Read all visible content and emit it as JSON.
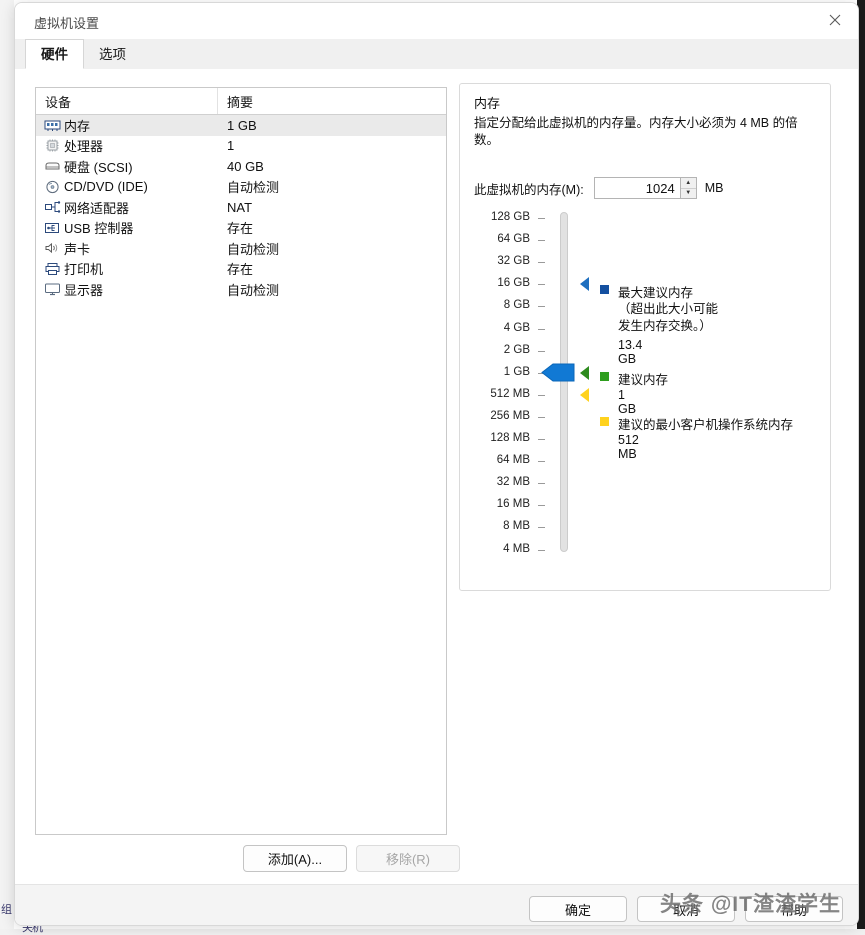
{
  "window": {
    "title": "虚拟机设置",
    "close_icon": "close-icon"
  },
  "tabs": [
    {
      "label": "硬件",
      "active": true
    },
    {
      "label": "选项",
      "active": false
    }
  ],
  "device_table": {
    "columns": [
      "设备",
      "摘要"
    ],
    "rows": [
      {
        "icon": "memory-icon",
        "device": "内存",
        "summary": "1 GB",
        "selected": true
      },
      {
        "icon": "cpu-icon",
        "device": "处理器",
        "summary": "1",
        "selected": false
      },
      {
        "icon": "harddisk-icon",
        "device": "硬盘 (SCSI)",
        "summary": "40 GB",
        "selected": false
      },
      {
        "icon": "cddvd-icon",
        "device": "CD/DVD (IDE)",
        "summary": "自动检测",
        "selected": false
      },
      {
        "icon": "network-icon",
        "device": "网络适配器",
        "summary": "NAT",
        "selected": false
      },
      {
        "icon": "usb-icon",
        "device": "USB 控制器",
        "summary": "存在",
        "selected": false
      },
      {
        "icon": "sound-icon",
        "device": "声卡",
        "summary": "自动检测",
        "selected": false
      },
      {
        "icon": "printer-icon",
        "device": "打印机",
        "summary": "存在",
        "selected": false
      },
      {
        "icon": "display-icon",
        "device": "显示器",
        "summary": "自动检测",
        "selected": false
      }
    ]
  },
  "list_buttons": {
    "add": "添加(A)...",
    "remove": "移除(R)"
  },
  "memory_panel": {
    "title": "内存",
    "description": "指定分配给此虚拟机的内存量。内存大小必须为 4 MB 的倍数。",
    "field_label": "此虚拟机的内存(M):",
    "field_value": "1024",
    "field_unit": "MB",
    "spinner_up_icon": "chevron-up-icon",
    "spinner_down_icon": "chevron-down-icon",
    "scale_labels": [
      "128 GB",
      "64 GB",
      "32 GB",
      "16 GB",
      "8 GB",
      "4 GB",
      "2 GB",
      "1 GB",
      "512 MB",
      "256 MB",
      "128 MB",
      "64 MB",
      "32 MB",
      "16 MB",
      "8 MB",
      "4 MB"
    ],
    "handle_value": "1 GB",
    "legend": [
      {
        "color": "#1450a0",
        "marker_color": "#1f6fbf",
        "name": "最大建议内存",
        "note": "（超出此大小可能\n发生内存交换。）",
        "value": "13.4 GB"
      },
      {
        "color": "#2e9e1e",
        "marker_color": "#2e8b1e",
        "name": "建议内存",
        "note": "",
        "value": "1 GB"
      },
      {
        "color": "#ffd21e",
        "marker_color": "#ffd21e",
        "name": "建议的最小客户机操作系统内存",
        "note": "",
        "value": "512 MB"
      }
    ]
  },
  "footer_buttons": {
    "ok": "确定",
    "cancel": "取消",
    "help": "帮助"
  },
  "watermark": "头条 @IT渣渣学生",
  "background_text": {
    "left_fragment": "组",
    "bottom_fragment": "关机"
  },
  "colors": {
    "slider_handle": "#1179d4",
    "selection": "#eaeaea",
    "accent_blue": "#1450a0",
    "accent_green": "#2e9e1e",
    "accent_yellow": "#ffd21e"
  }
}
